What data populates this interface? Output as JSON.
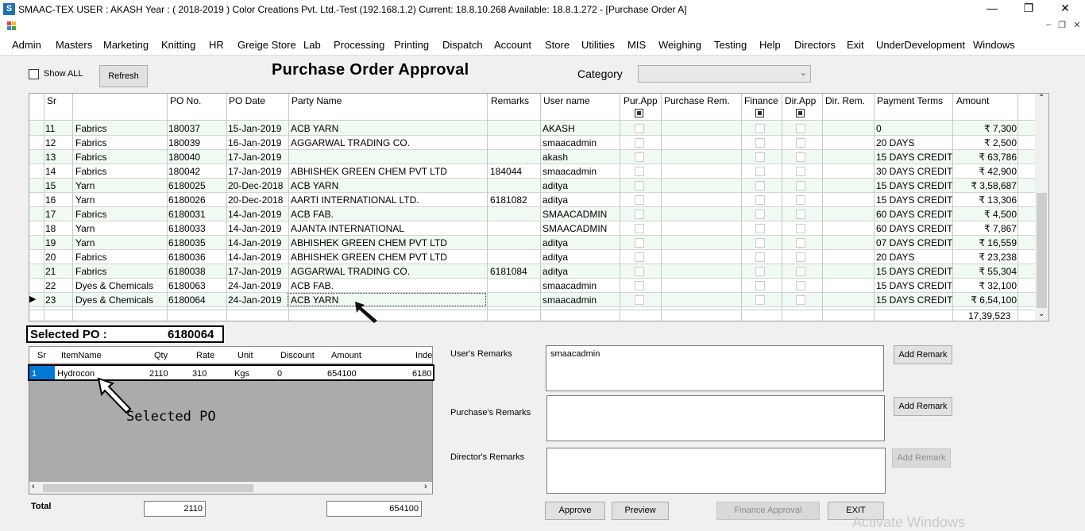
{
  "window": {
    "title": "SMAAC-TEX  USER : AKASH  Year : ( 2018-2019 )   Color Creations Pvt. Ltd.-Test (192.168.1.2)  Current: 18.8.10.268  Available: 18.8.1.272  - [Purchase Order A]",
    "app_icon": "S"
  },
  "menu": [
    "Admin",
    "Masters",
    "Marketing",
    "Knitting",
    "HR",
    "Greige Store",
    "Lab",
    "Processing",
    "Printing",
    "Dispatch",
    "Account",
    "Store",
    "Utilities",
    "MIS",
    "Weighing",
    "Testing",
    "Help",
    "Directors",
    "Exit",
    "UnderDevelopment",
    "Windows"
  ],
  "toolbar": {
    "show_all_label": "Show ALL",
    "show_all_checked": false,
    "refresh_label": "Refresh",
    "page_title": "Purchase Order Approval",
    "category_label": "Category",
    "category_value": ""
  },
  "grid": {
    "columns": [
      "Sr",
      "",
      "PO No.",
      "PO Date",
      "Party Name",
      "Remarks",
      "User name",
      "Pur.App",
      "Purchase Rem.",
      "Finance",
      "Dir.App",
      "Dir. Rem.",
      "Payment Terms",
      "Amount"
    ],
    "rows": [
      [
        "11",
        "Fabrics",
        "180037",
        "15-Jan-2019",
        "ACB YARN",
        "",
        "AKASH",
        "",
        "",
        "",
        "",
        "",
        "0",
        "₹ 7,300"
      ],
      [
        "12",
        "Fabrics",
        "180039",
        "16-Jan-2019",
        "AGGARWAL TRADING CO.",
        "",
        "smaacadmin",
        "",
        "",
        "",
        "",
        "",
        "20 DAYS",
        "₹ 2,500"
      ],
      [
        "13",
        "Fabrics",
        "180040",
        "17-Jan-2019",
        "",
        "",
        "akash",
        "",
        "",
        "",
        "",
        "",
        "15 DAYS CREDIT",
        "₹ 63,786"
      ],
      [
        "14",
        "Fabrics",
        "180042",
        "17-Jan-2019",
        "ABHISHEK GREEN CHEM PVT LTD",
        "184044",
        "smaacadmin",
        "",
        "",
        "",
        "",
        "",
        "30 DAYS CREDIT",
        "₹ 42,900"
      ],
      [
        "15",
        "Yarn",
        "6180025",
        "20-Dec-2018",
        "ACB YARN",
        "",
        "aditya",
        "",
        "",
        "",
        "",
        "",
        "15 DAYS CREDIT",
        "₹ 3,58,687"
      ],
      [
        "16",
        "Yarn",
        "6180026",
        "20-Dec-2018",
        "AARTI INTERNATIONAL LTD.",
        "6181082",
        "aditya",
        "",
        "",
        "",
        "",
        "",
        "15 DAYS CREDIT",
        "₹ 13,306"
      ],
      [
        "17",
        "Fabrics",
        "6180031",
        "14-Jan-2019",
        "ACB FAB.",
        "",
        "SMAACADMIN",
        "",
        "",
        "",
        "",
        "",
        "60 DAYS CREDIT",
        "₹ 4,500"
      ],
      [
        "18",
        "Yarn",
        "6180033",
        "14-Jan-2019",
        "AJANTA INTERNATIONAL",
        "",
        "SMAACADMIN",
        "",
        "",
        "",
        "",
        "",
        "60 DAYS CREDIT",
        "₹ 7,867"
      ],
      [
        "19",
        "Yarn",
        "6180035",
        "14-Jan-2019",
        "ABHISHEK GREEN CHEM PVT LTD",
        "",
        "aditya",
        "",
        "",
        "",
        "",
        "",
        "07 DAYS CREDIT",
        "₹ 16,559"
      ],
      [
        "20",
        "Fabrics",
        "6180036",
        "14-Jan-2019",
        "ABHISHEK GREEN CHEM PVT LTD",
        "",
        "aditya",
        "",
        "",
        "",
        "",
        "",
        "20 DAYS",
        "₹ 23,238"
      ],
      [
        "21",
        "Fabrics",
        "6180038",
        "17-Jan-2019",
        "AGGARWAL TRADING CO.",
        "6181084",
        "aditya",
        "",
        "",
        "",
        "",
        "",
        "15 DAYS CREDIT",
        "₹ 55,304"
      ],
      [
        "22",
        "Dyes & Chemicals",
        "6180063",
        "24-Jan-2019",
        "ACB FAB.",
        "",
        "smaacadmin",
        "",
        "",
        "",
        "",
        "",
        "15 DAYS CREDIT",
        "₹ 32,100"
      ],
      [
        "23",
        "Dyes & Chemicals",
        "6180064",
        "24-Jan-2019",
        "ACB YARN",
        "",
        "smaacadmin",
        "",
        "",
        "",
        "",
        "",
        "15 DAYS CREDIT",
        "₹ 6,54,100"
      ]
    ],
    "total_amount": "17,39,523",
    "current_row_marker": "▶"
  },
  "selected_po": {
    "label": "Selected PO :",
    "value": "6180064"
  },
  "items": {
    "columns": [
      "Sr",
      "ItemName",
      "Qty",
      "Rate",
      "Unit",
      "Discount",
      "Amount",
      "Inde"
    ],
    "row": [
      "1",
      "Hydrocon",
      "2110",
      "310",
      "Kgs",
      "0",
      "654100",
      "6180"
    ],
    "annotation": "Selected PO"
  },
  "totals": {
    "label": "Total",
    "qty": "2110",
    "amount": "654100"
  },
  "remarks": {
    "users_label": "User's Remarks",
    "users_value": "smaacadmin",
    "purchase_label": "Purchase's  Remarks",
    "purchase_value": "",
    "director_label": "Director's Remarks",
    "director_value": "",
    "add_remark_label": "Add Remark"
  },
  "actions": {
    "approve": "Approve",
    "preview": "Preview",
    "finance_approval": "Finance Approval",
    "exit": "EXIT"
  },
  "watermark": "Activate Windows",
  "colors": {
    "row_alt": "#f0faf2",
    "selection": "#0078d7",
    "accent": "#1f6fb4"
  }
}
